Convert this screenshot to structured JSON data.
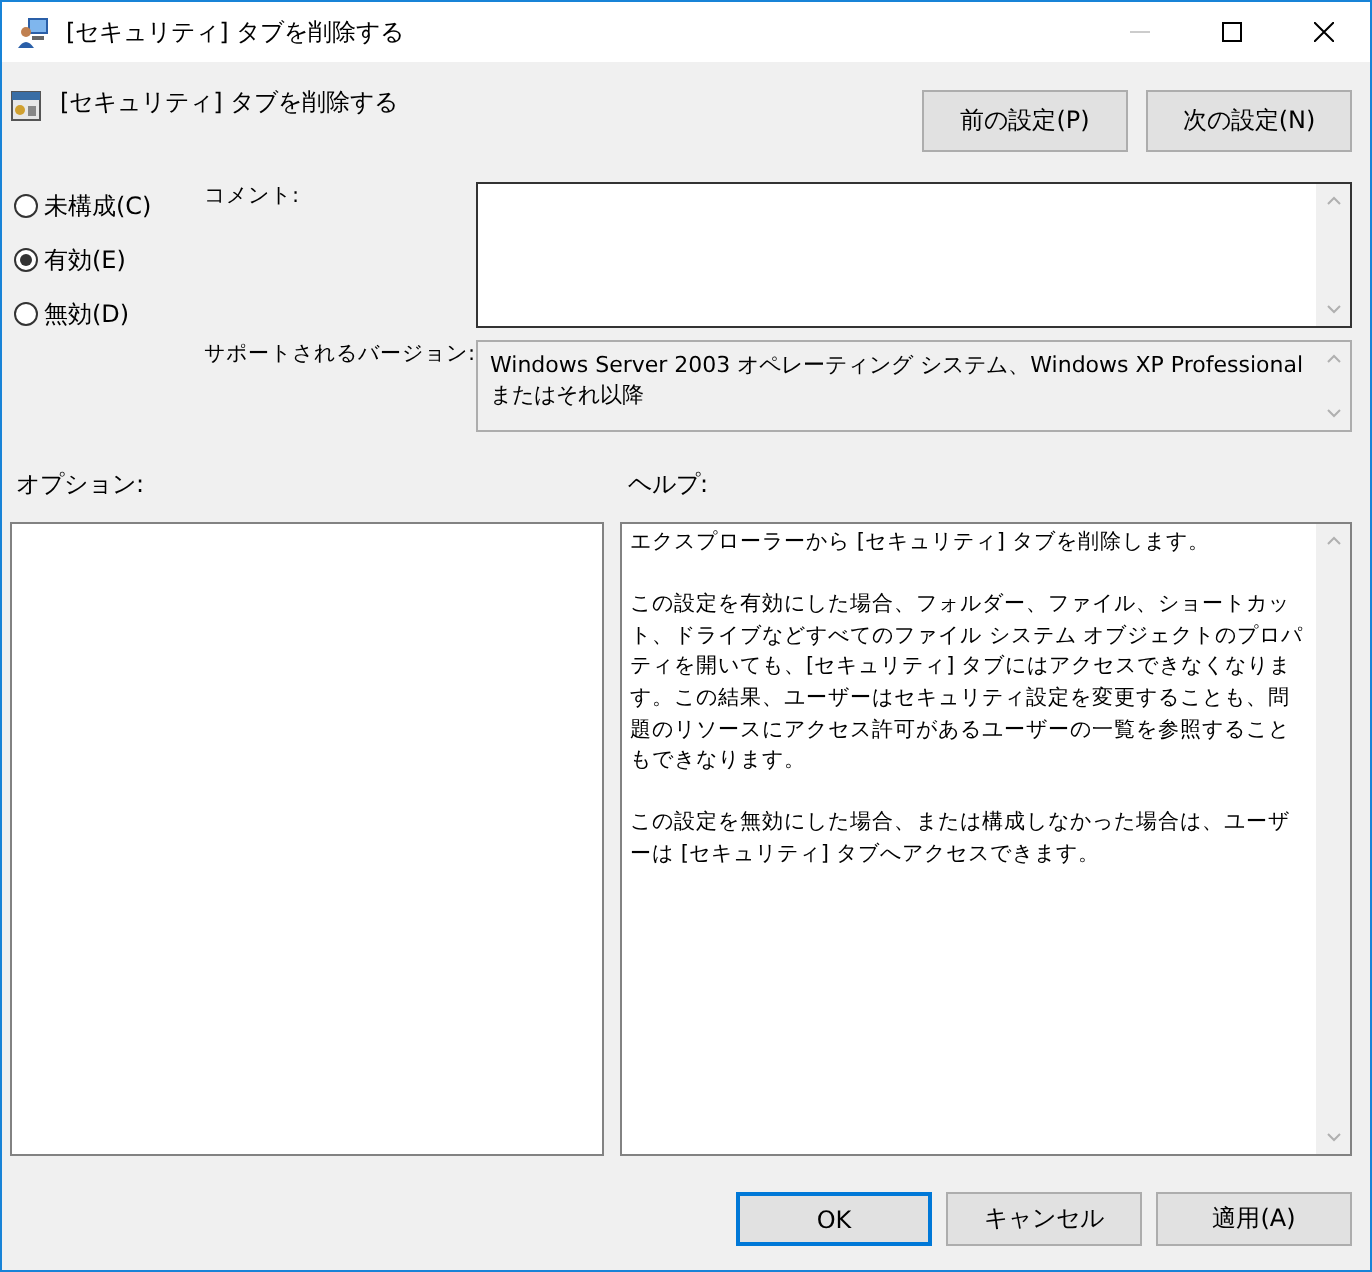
{
  "window": {
    "title": "[セキュリティ] タブを削除する"
  },
  "policy": {
    "title": "[セキュリティ] タブを削除する"
  },
  "nav_buttons": [
    "前の設定(P)",
    "次の設定(N)"
  ],
  "states": [
    {
      "label": "未構成(C)",
      "selected": false
    },
    {
      "label": "有効(E)",
      "selected": true
    },
    {
      "label": "無効(D)",
      "selected": false
    }
  ],
  "comment": {
    "label": "コメント:"
  },
  "supported": {
    "label": "サポートされるバージョン:",
    "value": "Windows Server 2003 オペレーティング システム、Windows XP Professional またはそれ以降"
  },
  "options": {
    "label": "オプション:"
  },
  "help": {
    "label": "ヘルプ:",
    "paragraphs": [
      "エクスプローラーから [セキュリティ] タブを削除します。",
      "この設定を有効にした場合、フォルダー、ファイル、ショートカット、ドライブなどすべてのファイル システム オブジェクトのプロパティを開いても、[セキュリティ] タブにはアクセスできなくなります。この結果、ユーザーはセキュリティ設定を変更することも、問題のリソースにアクセス許可があるユーザーの一覧を参照することもできなります。",
      "この設定を無効にした場合、または構成しなかった場合は、ユーザーは [セキュリティ] タブへアクセスできます。"
    ]
  },
  "buttons": [
    {
      "label": "OK",
      "kind": "default"
    },
    {
      "label": "キャンセル",
      "kind": "normal"
    },
    {
      "label": "適用(A)",
      "kind": "normal"
    }
  ]
}
